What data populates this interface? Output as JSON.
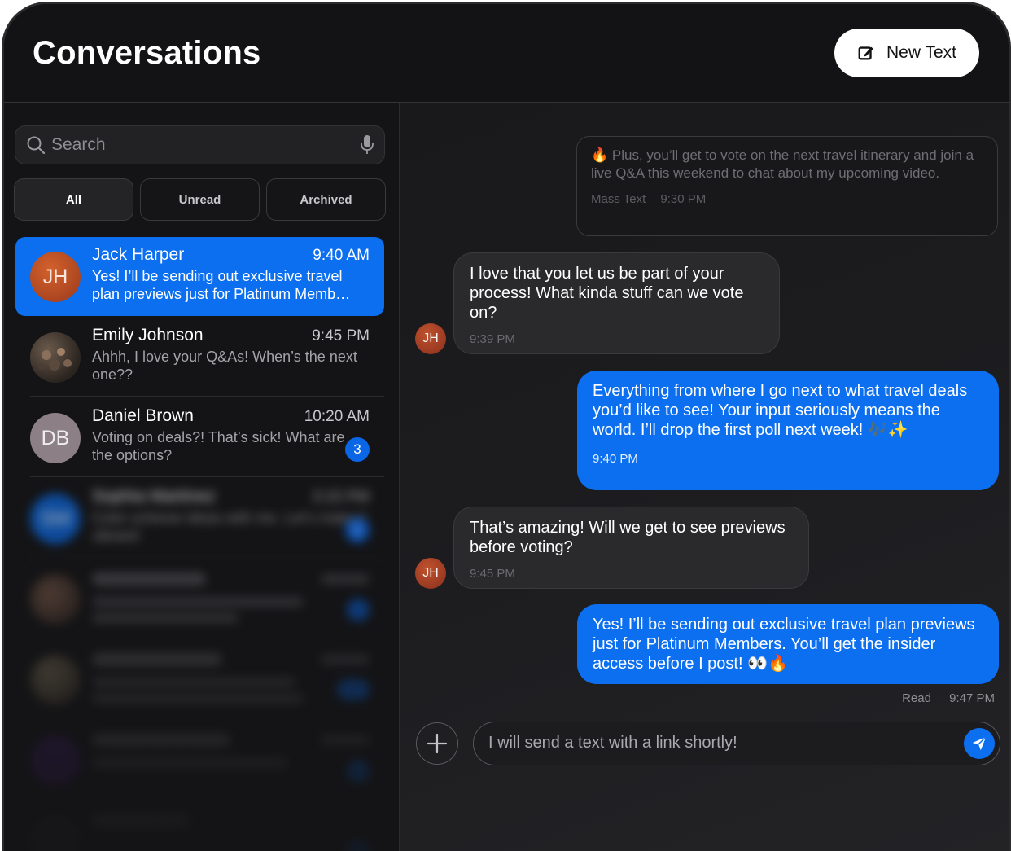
{
  "header": {
    "title": "Conversations",
    "new_text_label": "New Text"
  },
  "search": {
    "placeholder": "Search"
  },
  "filters": [
    "All",
    "Unread",
    "Archived"
  ],
  "active_filter": "All",
  "conversations": [
    {
      "name": "Jack Harper",
      "time": "9:40 AM",
      "preview": "Yes! I’ll be sending out exclusive travel plan previews just for Platinum Memb…",
      "initials": "JH",
      "selected": true
    },
    {
      "name": "Emily Johnson",
      "time": "9:45 PM",
      "preview": "Ahhh, I love your Q&As! When’s the next one??",
      "initials": ""
    },
    {
      "name": "Daniel Brown",
      "time": "10:20 AM",
      "preview": "Voting on deals?! That’s sick! What are the options?",
      "initials": "DB",
      "unread": "3"
    },
    {
      "name": "Sophia Martinez",
      "time": "3:15 PM",
      "preview": "Color scheme ideas with me. Let’s make it vibrant!",
      "initials": "SM",
      "unread": "1"
    }
  ],
  "chat": {
    "messages": [
      {
        "direction": "mass",
        "text": "🔥 Plus, you’ll get to vote on the next travel itinerary and join a live Q&A this weekend to chat about my upcoming video.",
        "label": "Mass Text",
        "time": "9:30 PM"
      },
      {
        "direction": "in",
        "text": "I love that you let us be part of your process! What kinda stuff can we vote on?",
        "time": "9:39 PM",
        "avatar": "JH"
      },
      {
        "direction": "out",
        "text": "Everything from where I go next to what travel deals you’d like to see! Your input seriously means the world. I’ll drop the first poll next week! 🎶✨",
        "time": "9:40 PM"
      },
      {
        "direction": "in",
        "text": "That’s amazing! Will we get to see previews before voting?",
        "time": "9:45 PM",
        "avatar": "JH"
      },
      {
        "direction": "out",
        "text": "Yes! I’ll be sending out exclusive travel plan previews just for Platinum Members. You’ll get the insider access before I post! 👀🔥"
      }
    ],
    "receipt_status": "Read",
    "receipt_time": "9:47 PM",
    "composer_text": "I will send a text with a link shortly!"
  },
  "colors": {
    "accent": "#0b6ff0",
    "background": "#141416"
  }
}
